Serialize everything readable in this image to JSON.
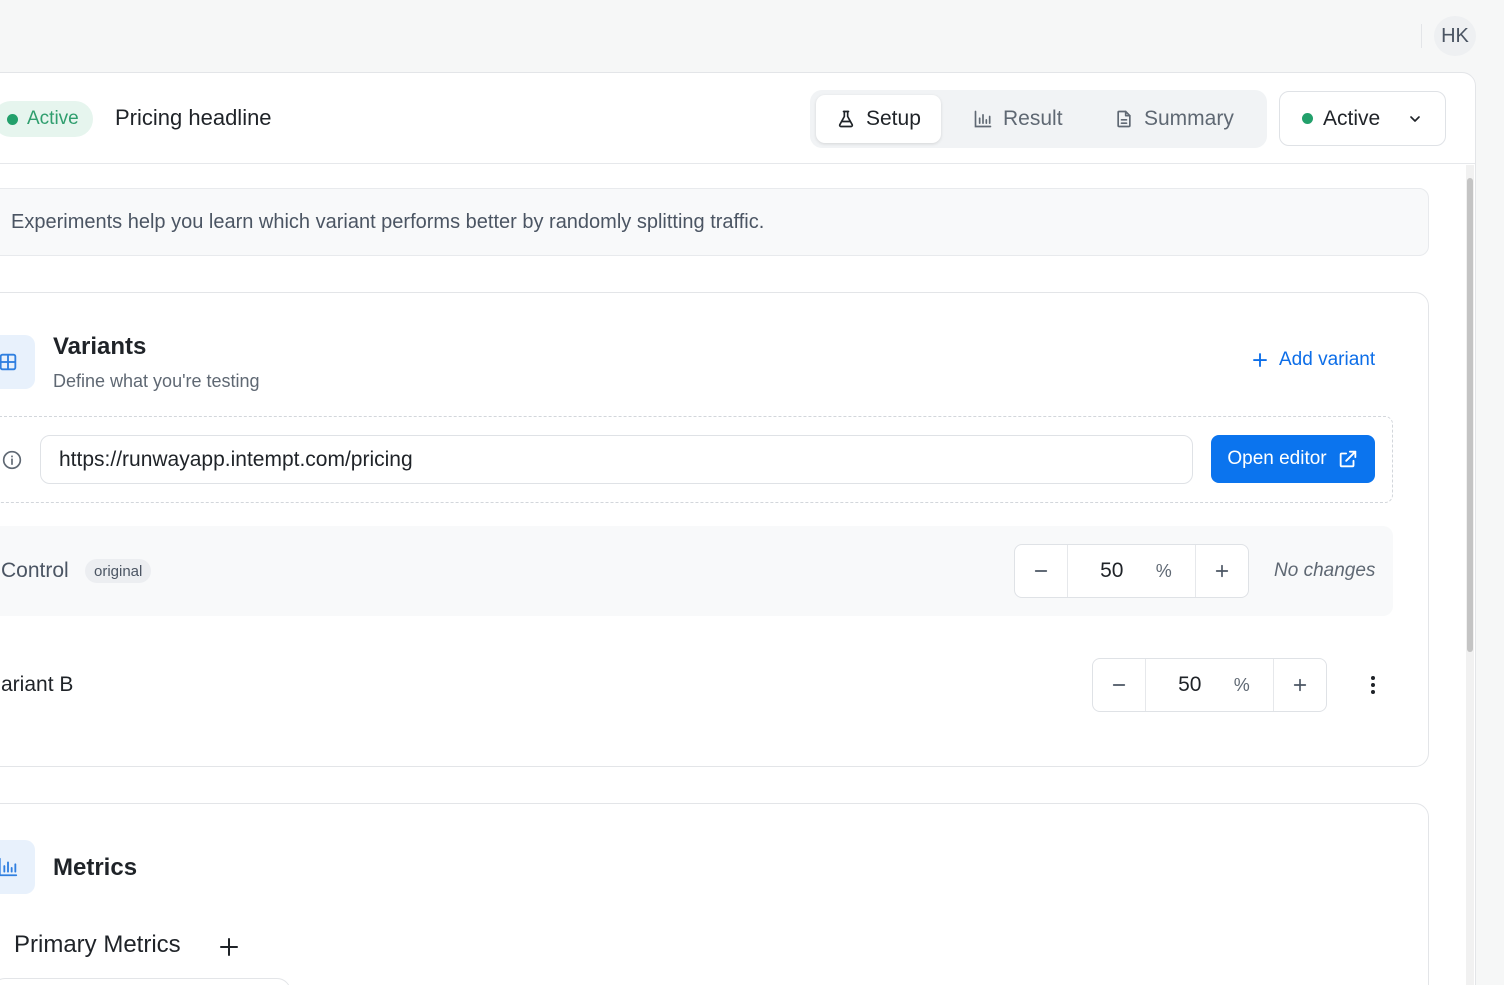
{
  "user": {
    "initials": "HK"
  },
  "experiment": {
    "status": "Active",
    "title": "Pricing headline"
  },
  "tabs": [
    {
      "label": "Setup",
      "icon": "flask-icon",
      "active": true
    },
    {
      "label": "Result",
      "icon": "bar-chart-icon",
      "active": false
    },
    {
      "label": "Summary",
      "icon": "document-icon",
      "active": false
    }
  ],
  "status_select": {
    "value": "Active"
  },
  "info_banner": {
    "text": "Experiments help you learn which variant performs better by randomly splitting traffic."
  },
  "variants_section": {
    "title": "Variants",
    "subtitle": "Define what you're testing",
    "add_label": "Add variant",
    "url": "https://runwayapp.intempt.com/pricing",
    "open_editor_label": "Open editor",
    "rows": [
      {
        "name": "Control",
        "badge": "original",
        "split": "50",
        "unit": "%",
        "note": "No changes"
      },
      {
        "name": "ariant B",
        "split": "50",
        "unit": "%"
      }
    ]
  },
  "metrics_section": {
    "title": "Metrics",
    "primary_label": "Primary Metrics"
  },
  "colors": {
    "accent": "#0b74ee",
    "active_green": "#22a06b",
    "status_pill_bg": "#e6f5ee"
  }
}
